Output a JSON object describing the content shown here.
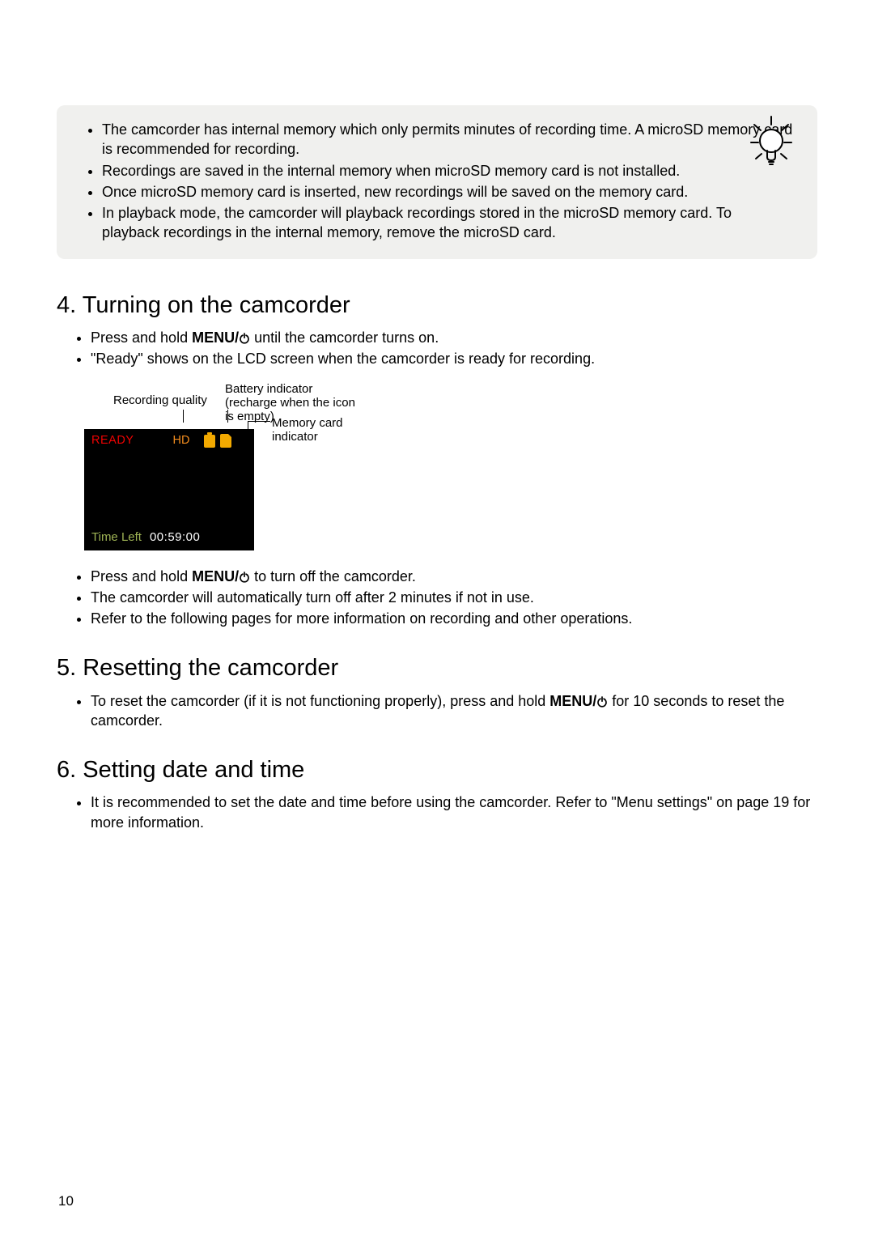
{
  "tip_box": {
    "items": [
      "The camcorder has internal memory which only permits minutes of recording time. A microSD memory card is recommended for recording.",
      "Recordings are saved in the internal memory when microSD memory card is not installed.",
      "Once microSD memory card is inserted, new recordings will be saved on the memory card.",
      "In playback mode, the camcorder will playback recordings stored in the microSD memory card. To playback recordings in the internal memory, remove the microSD card."
    ]
  },
  "sections": {
    "turning_on": {
      "heading": "4. Turning on the camcorder",
      "bullets_top": {
        "b0_pre": "Press and hold ",
        "b0_bold": "MENU/",
        "b0_post": " until the camcorder turns on.",
        "b1": "\"Ready\" shows on the LCD screen when the camcorder is ready for recording."
      },
      "lcd": {
        "annot_recording_quality": "Recording quality",
        "annot_battery": "Battery indicator (recharge when the icon is empty)",
        "annot_memcard": "Memory card indicator",
        "ready": "READY",
        "hd": "HD",
        "time_left_label": "Time Left",
        "time_left_value": "00:59:00"
      },
      "bullets_bottom": {
        "b0_pre": "Press and hold ",
        "b0_bold": "MENU/",
        "b0_post": " to turn off the camcorder.",
        "b1": "The camcorder will automatically turn off after 2 minutes if not in use.",
        "b2": "Refer to the following pages for more information on recording and other operations."
      }
    },
    "resetting": {
      "heading": "5. Resetting the camcorder",
      "b0_pre": "To reset the camcorder (if it is not functioning properly), press and hold ",
      "b0_bold": "MENU/",
      "b0_post": " for 10 seconds to reset the camcorder."
    },
    "date_time": {
      "heading": "6. Setting date and time",
      "b0": "It is recommended to set the date and time before using the camcorder. Refer to \"Menu settings\" on page 19 for more information."
    }
  },
  "page_number": "10"
}
